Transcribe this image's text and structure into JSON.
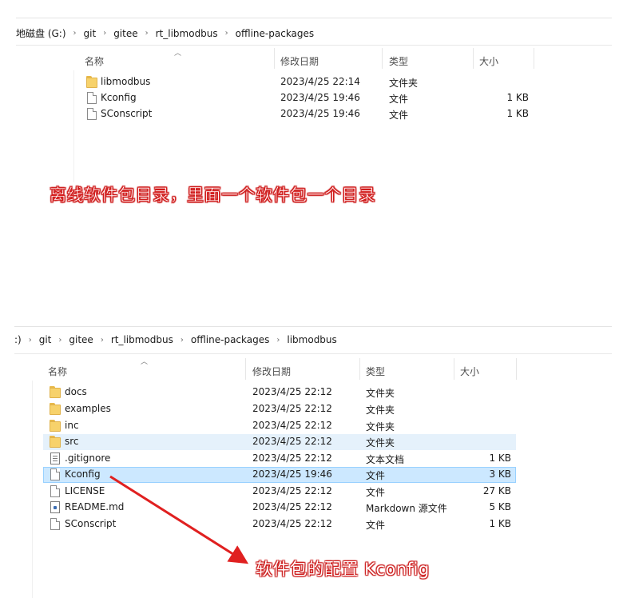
{
  "window1": {
    "breadcrumb": [
      "地磁盘 (G:)",
      "git",
      "gitee",
      "rt_libmodbus",
      "offline-packages"
    ],
    "columns": {
      "name": "名称",
      "modified": "修改日期",
      "type": "类型",
      "size": "大小"
    },
    "rows": [
      {
        "icon": "folder-icon",
        "name": "libmodbus",
        "modified": "2023/4/25 22:14",
        "type": "文件夹",
        "size": ""
      },
      {
        "icon": "file-icon",
        "name": "Kconfig",
        "modified": "2023/4/25 19:46",
        "type": "文件",
        "size": "1 KB"
      },
      {
        "icon": "file-icon",
        "name": "SConscript",
        "modified": "2023/4/25 19:46",
        "type": "文件",
        "size": "1 KB"
      }
    ]
  },
  "annotation1": "离线软件包目录，里面一个软件包一个目录",
  "window2": {
    "breadcrumb": [
      ":)",
      "git",
      "gitee",
      "rt_libmodbus",
      "offline-packages",
      "libmodbus"
    ],
    "columns": {
      "name": "名称",
      "modified": "修改日期",
      "type": "类型",
      "size": "大小"
    },
    "rows": [
      {
        "icon": "folder-icon",
        "name": "docs",
        "modified": "2023/4/25 22:12",
        "type": "文件夹",
        "size": "",
        "state": ""
      },
      {
        "icon": "folder-icon",
        "name": "examples",
        "modified": "2023/4/25 22:12",
        "type": "文件夹",
        "size": "",
        "state": ""
      },
      {
        "icon": "folder-icon",
        "name": "inc",
        "modified": "2023/4/25 22:12",
        "type": "文件夹",
        "size": "",
        "state": ""
      },
      {
        "icon": "folder-icon",
        "name": "src",
        "modified": "2023/4/25 22:12",
        "type": "文件夹",
        "size": "",
        "state": "hover"
      },
      {
        "icon": "text-file-icon",
        "name": ".gitignore",
        "modified": "2023/4/25 22:12",
        "type": "文本文档",
        "size": "1 KB",
        "state": ""
      },
      {
        "icon": "file-icon",
        "name": "Kconfig",
        "modified": "2023/4/25 19:46",
        "type": "文件",
        "size": "3 KB",
        "state": "selected"
      },
      {
        "icon": "file-icon",
        "name": "LICENSE",
        "modified": "2023/4/25 22:12",
        "type": "文件",
        "size": "27 KB",
        "state": ""
      },
      {
        "icon": "markdown-file-icon",
        "name": "README.md",
        "modified": "2023/4/25 22:12",
        "type": "Markdown 源文件",
        "size": "5 KB",
        "state": ""
      },
      {
        "icon": "file-icon",
        "name": "SConscript",
        "modified": "2023/4/25 22:12",
        "type": "文件",
        "size": "1 KB",
        "state": ""
      }
    ]
  },
  "annotation2": "软件包的配置 Kconfig",
  "colors": {
    "annotation": "#d81e1e",
    "hover": "#e5f1fb",
    "selected": "#cce8ff",
    "arrow": "#e02020"
  }
}
